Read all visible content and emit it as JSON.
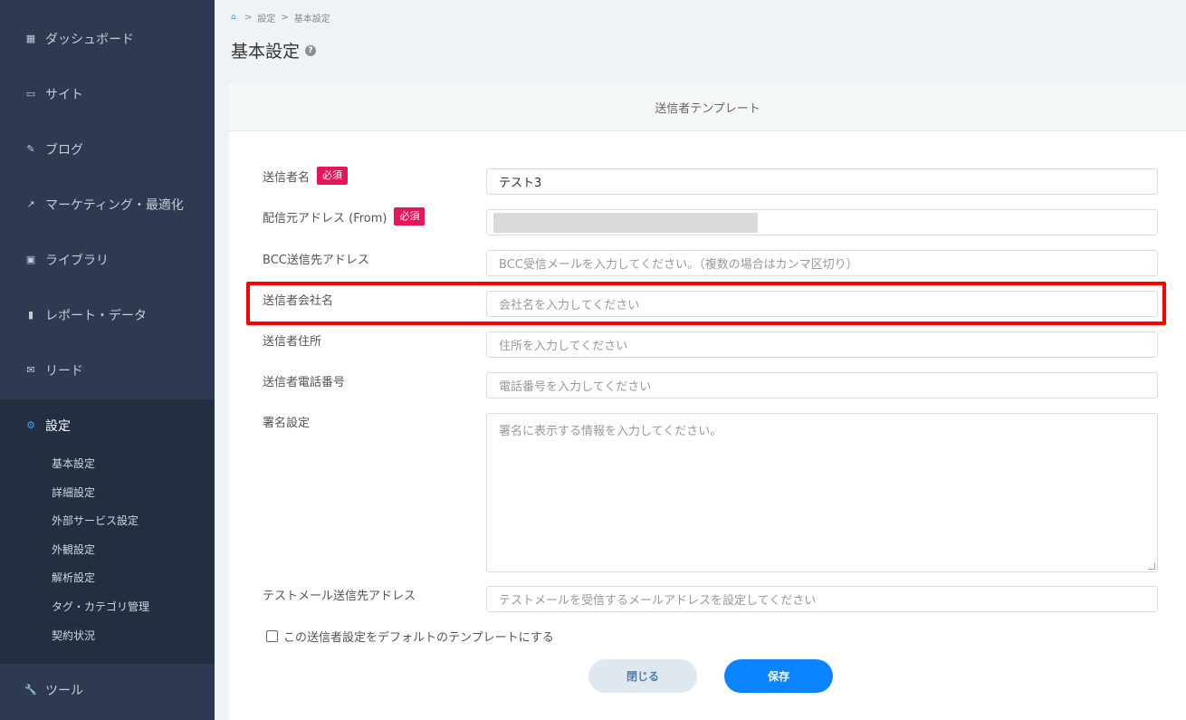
{
  "sidebar": {
    "items": [
      {
        "label": "ダッシュボード",
        "icon": "dashboard-icon"
      },
      {
        "label": "サイト",
        "icon": "site-icon"
      },
      {
        "label": "ブログ",
        "icon": "pencil-icon"
      },
      {
        "label": "マーケティング・最適化",
        "icon": "trend-icon"
      },
      {
        "label": "ライブラリ",
        "icon": "image-icon"
      },
      {
        "label": "レポート・データ",
        "icon": "bar-chart-icon"
      },
      {
        "label": "リード",
        "icon": "mail-icon"
      },
      {
        "label": "設定",
        "icon": "gear-icon"
      },
      {
        "label": "ツール",
        "icon": "wrench-icon"
      }
    ],
    "sub_items": [
      "基本設定",
      "詳細設定",
      "外部サービス設定",
      "外観設定",
      "解析設定",
      "タグ・カテゴリ管理",
      "契約状況"
    ]
  },
  "breadcrumb": {
    "sep": ">",
    "items": [
      "設定",
      "基本設定"
    ]
  },
  "page": {
    "title": "基本設定"
  },
  "card": {
    "header": "送信者テンプレート"
  },
  "form": {
    "required_badge": "必須",
    "sender_name": {
      "label": "送信者名",
      "value": "テスト3"
    },
    "from_address": {
      "label": "配信元アドレス (From)"
    },
    "bcc": {
      "label": "BCC送信先アドレス",
      "placeholder": "BCC受信メールを入力してください。（複数の場合はカンマ区切り）"
    },
    "company": {
      "label": "送信者会社名",
      "placeholder": "会社名を入力してください"
    },
    "address": {
      "label": "送信者住所",
      "placeholder": "住所を入力してください"
    },
    "phone": {
      "label": "送信者電話番号",
      "placeholder": "電話番号を入力してください"
    },
    "signature": {
      "label": "署名設定",
      "placeholder": "署名に表示する情報を入力してください。"
    },
    "test_mail": {
      "label": "テストメール送信先アドレス",
      "placeholder": "テストメールを受信するメールアドレスを設定してください"
    },
    "default_checkbox": "この送信者設定をデフォルトのテンプレートにする"
  },
  "buttons": {
    "close": "閉じる",
    "save": "保存"
  },
  "colors": {
    "sidebar": "#2e3a51",
    "accent": "#0a84ff",
    "required": "#e6155a",
    "highlight": "#ff0000"
  }
}
